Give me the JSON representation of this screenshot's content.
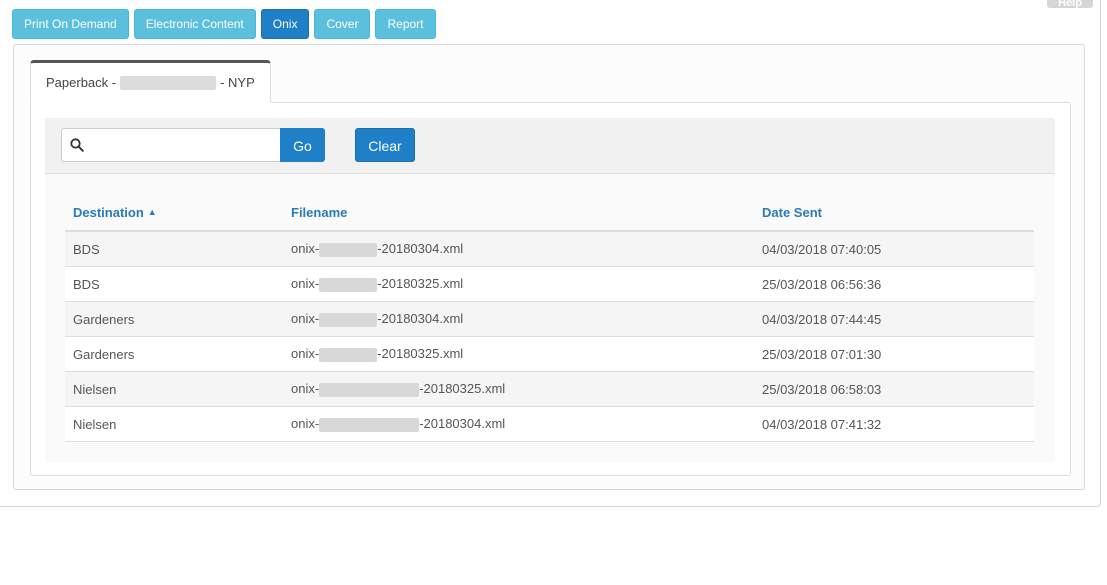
{
  "header_buttons": [
    {
      "label": "Print On Demand",
      "active": false
    },
    {
      "label": "Electronic Content",
      "active": false
    },
    {
      "label": "Onix",
      "active": true
    },
    {
      "label": "Cover",
      "active": false
    },
    {
      "label": "Report",
      "active": false
    }
  ],
  "help_label": "Help",
  "tab": {
    "prefix": "Paperback - ",
    "suffix": " - NYP"
  },
  "search": {
    "placeholder": "",
    "value": "",
    "go_label": "Go",
    "clear_label": "Clear",
    "icon": "search-icon"
  },
  "table": {
    "columns": [
      "Destination",
      "Filename",
      "Date Sent"
    ],
    "sorted_column": "Destination",
    "sort_direction": "ascending",
    "rows": [
      {
        "destination": "BDS",
        "filename_prefix": "onix-",
        "filename_suffix": "-20180304.xml",
        "date_sent": "04/03/2018 07:40:05"
      },
      {
        "destination": "BDS",
        "filename_prefix": "onix-",
        "filename_suffix": "-20180325.xml",
        "date_sent": "25/03/2018 06:56:36"
      },
      {
        "destination": "Gardeners",
        "filename_prefix": "onix-",
        "filename_suffix": "-20180304.xml",
        "date_sent": "04/03/2018 07:44:45"
      },
      {
        "destination": "Gardeners",
        "filename_prefix": "onix-",
        "filename_suffix": "-20180325.xml",
        "date_sent": "25/03/2018 07:01:30"
      },
      {
        "destination": "Nielsen",
        "filename_prefix": "onix-",
        "filename_suffix": "-20180325.xml",
        "date_sent": "25/03/2018 06:58:03"
      },
      {
        "destination": "Nielsen",
        "filename_prefix": "onix-",
        "filename_suffix": "-20180304.xml",
        "date_sent": "04/03/2018 07:41:32"
      }
    ]
  },
  "colors": {
    "button_info": "#5bc0de",
    "button_primary": "#1f7fc7",
    "link_header": "#2a7ab8"
  }
}
